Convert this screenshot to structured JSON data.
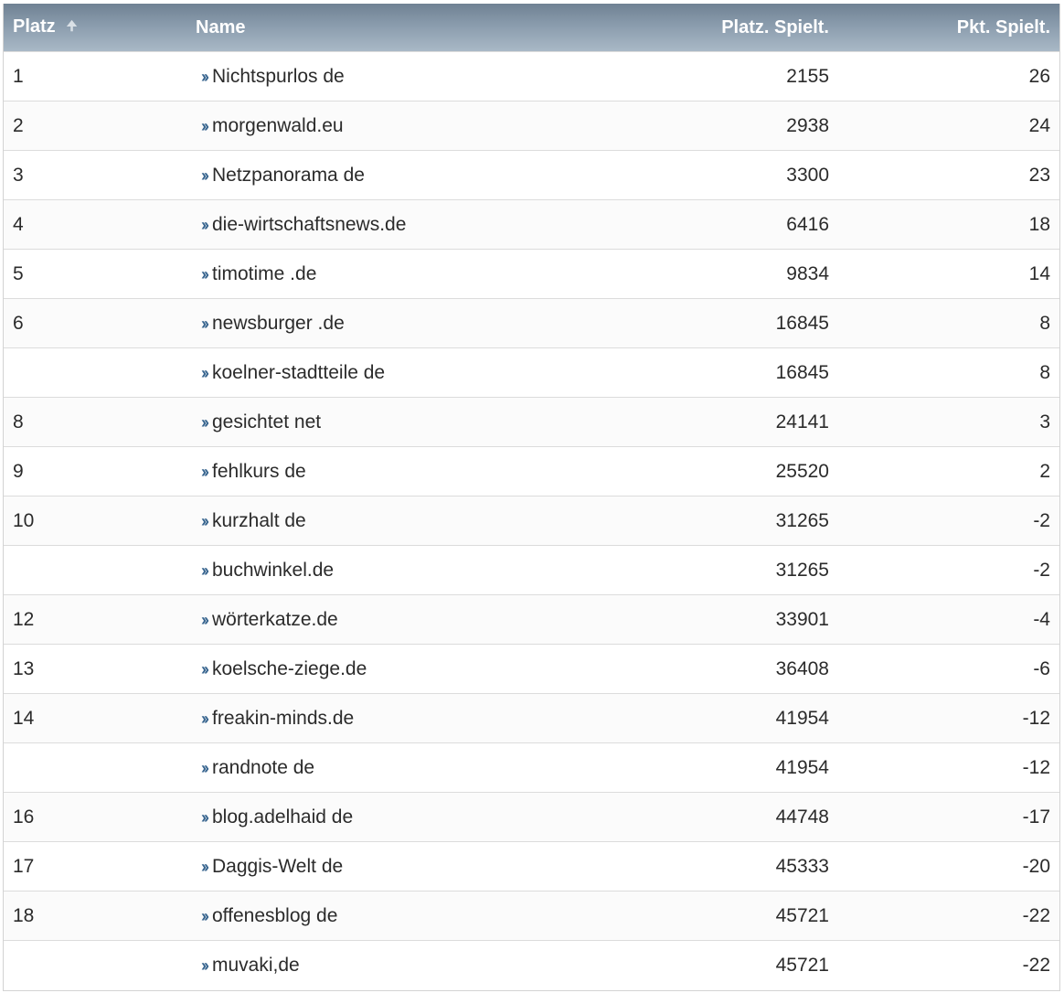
{
  "columns": {
    "platz": "Platz",
    "name": "Name",
    "platz_spielt": "Platz. Spielt.",
    "pkt_spielt": "Pkt. Spielt."
  },
  "sort_icon": "sort-ascending-arrow-icon",
  "rows": [
    {
      "platz": "1",
      "name": "Nichtspurlos de",
      "platz_spielt": "2155",
      "pkt_spielt": "26"
    },
    {
      "platz": "2",
      "name": "morgenwald.eu",
      "platz_spielt": "2938",
      "pkt_spielt": "24"
    },
    {
      "platz": "3",
      "name": "Netzpanorama de",
      "platz_spielt": "3300",
      "pkt_spielt": "23"
    },
    {
      "platz": "4",
      "name": "die-wirtschaftsnews.de",
      "platz_spielt": "6416",
      "pkt_spielt": "18"
    },
    {
      "platz": "5",
      "name": "timotime .de",
      "platz_spielt": "9834",
      "pkt_spielt": "14"
    },
    {
      "platz": "6",
      "name": "newsburger .de",
      "platz_spielt": "16845",
      "pkt_spielt": "8"
    },
    {
      "platz": "",
      "name": "koelner-stadtteile de",
      "platz_spielt": "16845",
      "pkt_spielt": "8"
    },
    {
      "platz": "8",
      "name": "gesichtet net",
      "platz_spielt": "24141",
      "pkt_spielt": "3"
    },
    {
      "platz": "9",
      "name": "fehlkurs de",
      "platz_spielt": "25520",
      "pkt_spielt": "2"
    },
    {
      "platz": "10",
      "name": "kurzhalt de",
      "platz_spielt": "31265",
      "pkt_spielt": "-2"
    },
    {
      "platz": "",
      "name": "buchwinkel.de",
      "platz_spielt": "31265",
      "pkt_spielt": "-2"
    },
    {
      "platz": "12",
      "name": "wörterkatze.de",
      "platz_spielt": "33901",
      "pkt_spielt": "-4"
    },
    {
      "platz": "13",
      "name": "koelsche-ziege.de",
      "platz_spielt": "36408",
      "pkt_spielt": "-6"
    },
    {
      "platz": "14",
      "name": "freakin-minds.de",
      "platz_spielt": "41954",
      "pkt_spielt": "-12"
    },
    {
      "platz": "",
      "name": "randnote de",
      "platz_spielt": "41954",
      "pkt_spielt": "-12"
    },
    {
      "platz": "16",
      "name": "blog.adelhaid de",
      "platz_spielt": "44748",
      "pkt_spielt": "-17"
    },
    {
      "platz": "17",
      "name": "Daggis-Welt de",
      "platz_spielt": "45333",
      "pkt_spielt": "-20"
    },
    {
      "platz": "18",
      "name": "offenesblog de",
      "platz_spielt": "45721",
      "pkt_spielt": "-22"
    },
    {
      "platz": "",
      "name": "muvaki,de",
      "platz_spielt": "45721",
      "pkt_spielt": "-22"
    }
  ]
}
